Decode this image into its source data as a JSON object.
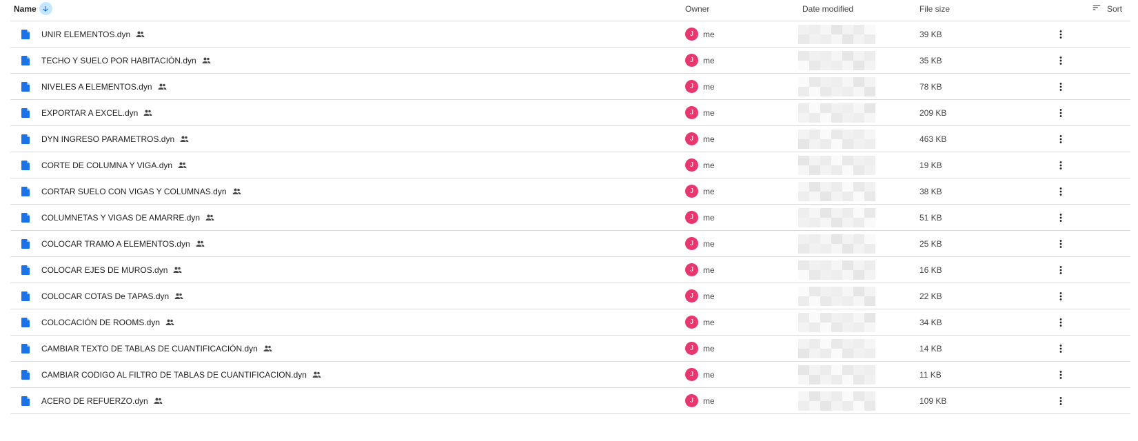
{
  "header": {
    "name_label": "Name",
    "owner_label": "Owner",
    "date_label": "Date modified",
    "size_label": "File size",
    "sort_label": "Sort"
  },
  "colors": {
    "file_icon": "#1a73e8",
    "avatar": "#e8376f",
    "sort_arrow_bg": "#c2e7ff"
  },
  "files": [
    {
      "name": "UNIR ELEMENTOS.dyn",
      "owner_initial": "J",
      "owner": "me",
      "size": "39 KB"
    },
    {
      "name": "TECHO Y SUELO POR HABITACIÓN.dyn",
      "owner_initial": "J",
      "owner": "me",
      "size": "35 KB"
    },
    {
      "name": "NIVELES A ELEMENTOS.dyn",
      "owner_initial": "J",
      "owner": "me",
      "size": "78 KB"
    },
    {
      "name": "EXPORTAR A EXCEL.dyn",
      "owner_initial": "J",
      "owner": "me",
      "size": "209 KB"
    },
    {
      "name": "DYN INGRESO PARAMETROS.dyn",
      "owner_initial": "J",
      "owner": "me",
      "size": "463 KB"
    },
    {
      "name": "CORTE DE COLUMNA Y VIGA.dyn",
      "owner_initial": "J",
      "owner": "me",
      "size": "19 KB"
    },
    {
      "name": "CORTAR SUELO CON VIGAS Y COLUMNAS.dyn",
      "owner_initial": "J",
      "owner": "me",
      "size": "38 KB"
    },
    {
      "name": "COLUMNETAS Y VIGAS DE AMARRE.dyn",
      "owner_initial": "J",
      "owner": "me",
      "size": "51 KB"
    },
    {
      "name": "COLOCAR TRAMO A ELEMENTOS.dyn",
      "owner_initial": "J",
      "owner": "me",
      "size": "25 KB"
    },
    {
      "name": "COLOCAR EJES DE MUROS.dyn",
      "owner_initial": "J",
      "owner": "me",
      "size": "16 KB"
    },
    {
      "name": "COLOCAR COTAS De TAPAS.dyn",
      "owner_initial": "J",
      "owner": "me",
      "size": "22 KB"
    },
    {
      "name": "COLOCACIÓN DE ROOMS.dyn",
      "owner_initial": "J",
      "owner": "me",
      "size": "34 KB"
    },
    {
      "name": "CAMBIAR TEXTO DE TABLAS DE CUANTIFICACIÓN.dyn",
      "owner_initial": "J",
      "owner": "me",
      "size": "14 KB"
    },
    {
      "name": "CAMBIAR CODIGO AL FILTRO DE TABLAS DE CUANTIFICACION.dyn",
      "owner_initial": "J",
      "owner": "me",
      "size": "11 KB"
    },
    {
      "name": "ACERO DE REFUERZO.dyn",
      "owner_initial": "J",
      "owner": "me",
      "size": "109 KB"
    }
  ]
}
